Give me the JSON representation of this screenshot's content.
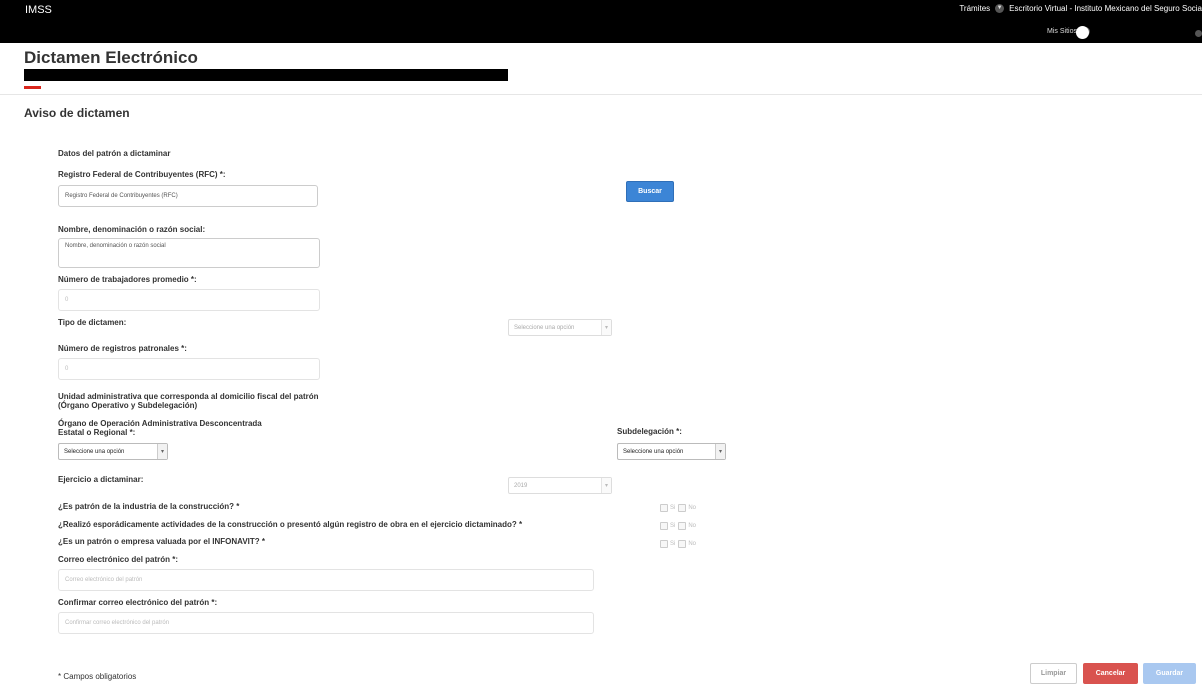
{
  "topbar": {
    "brand": "IMSS",
    "nav_tramites": "Trámites",
    "nav_escritorio": "Escritorio Virtual - Instituto Mexicano del Seguro Socia",
    "mis_sitios": "Mis Sitios"
  },
  "header": {
    "title": "Dictamen Electrónico"
  },
  "section_title": "Aviso de dictamen",
  "subsection_title": "Datos del patrón a dictaminar",
  "form": {
    "rfc": {
      "label": "Registro Federal de Contribuyentes (RFC) *:",
      "placeholder": "Registro Federal de Contribuyentes (RFC)"
    },
    "buscar_label": "Buscar",
    "razon_social": {
      "label": "Nombre, denominación o razón social:",
      "placeholder": "Nombre, denominación o razón social"
    },
    "num_trabajadores": {
      "label": "Número de trabajadores promedio *:",
      "value": "0"
    },
    "tipo_dictamen": {
      "label": "Tipo de dictamen:",
      "selected": "Seleccione una opción"
    },
    "num_registros": {
      "label": "Número de registros patronales *:",
      "value": "0"
    },
    "unidad_admin": {
      "line1": "Unidad administrativa que corresponda al domicilio fiscal del patrón",
      "line2": "(Órgano Operativo y Subdelegación)"
    },
    "organo": {
      "line1": "Órgano de Operación Administrativa Desconcentrada",
      "line2": "Estatal o Regional *:",
      "selected": "Seleccione una opción"
    },
    "subdelegacion": {
      "label": "Subdelegación *:",
      "selected": "Seleccione una opción"
    },
    "ejercicio": {
      "label": "Ejercicio a dictaminar:",
      "selected": "2019"
    },
    "q_construccion": {
      "label": "¿Es patrón de la industria de la construcción? *",
      "yes": "Si",
      "no": "No"
    },
    "q_esporadica": {
      "label": "¿Realizó esporádicamente actividades de la construcción o presentó algún registro de obra en el ejercicio dictaminado? *",
      "yes": "Si",
      "no": "No"
    },
    "q_infonavit": {
      "label": "¿Es un patrón o empresa valuada por el INFONAVIT? *",
      "yes": "Si",
      "no": "No"
    },
    "correo": {
      "label": "Correo electrónico del patrón *:",
      "placeholder": "Correo electrónico del patrón"
    },
    "confirmar_correo": {
      "label": "Confirmar correo electrónico del patrón *:",
      "placeholder": "Confirmar correo electrónico del patrón"
    }
  },
  "footer": {
    "required_note": "* Campos obligatorios",
    "limpiar": "Limpiar",
    "cancelar": "Cancelar",
    "guardar": "Guardar"
  },
  "colors": {
    "topbar": "#000000",
    "accent_red": "#d9261c",
    "buscar_blue": "#3c85d6",
    "cancelar_red": "#d9534f",
    "guardar_disabled_blue": "#a9c8f0"
  }
}
